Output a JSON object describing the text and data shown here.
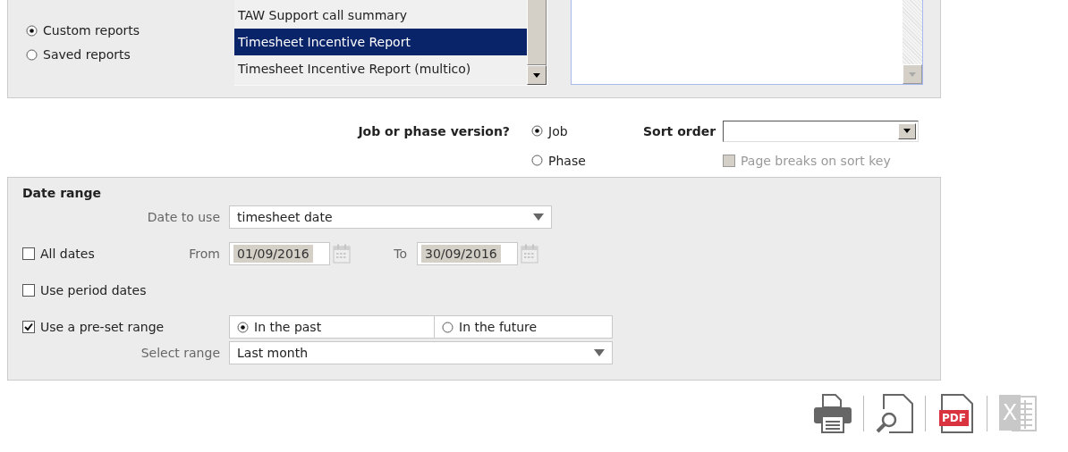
{
  "report_type": {
    "options": [
      {
        "label": "Custom reports",
        "selected": true
      },
      {
        "label": "Saved reports",
        "selected": false
      }
    ]
  },
  "report_list": {
    "items": [
      {
        "label": "TAW Support call summary",
        "selected": false
      },
      {
        "label": "Timesheet Incentive Report",
        "selected": true
      },
      {
        "label": "Timesheet Incentive Report (multico)",
        "selected": false
      }
    ]
  },
  "version": {
    "label": "Job or phase version?",
    "options": [
      {
        "label": "Job",
        "selected": true
      },
      {
        "label": "Phase",
        "selected": false
      }
    ]
  },
  "sort_order": {
    "label": "Sort order",
    "page_breaks": {
      "label": "Page breaks on sort key",
      "checked": false,
      "disabled": true
    }
  },
  "date_range": {
    "title": "Date range",
    "date_to_use": {
      "label": "Date to use",
      "value": "timesheet date"
    },
    "all_dates": {
      "label": "All dates",
      "checked": false
    },
    "from": {
      "label": "From",
      "value": "01/09/2016",
      "disabled": true
    },
    "to": {
      "label": "To",
      "value": "30/09/2016",
      "disabled": true
    },
    "use_period_dates": {
      "label": "Use period dates",
      "checked": false
    },
    "use_preset": {
      "label": "Use a pre-set range",
      "checked": true
    },
    "direction": [
      {
        "label": "In the past",
        "selected": true
      },
      {
        "label": "In the future",
        "selected": false
      }
    ],
    "select_range": {
      "label": "Select range",
      "value": "Last month"
    }
  },
  "export_buttons": [
    {
      "kind": "print",
      "disabled": false
    },
    {
      "kind": "preview",
      "disabled": false
    },
    {
      "kind": "pdf",
      "label": "PDF",
      "disabled": false
    },
    {
      "kind": "excel",
      "label": "X",
      "disabled": true
    }
  ]
}
